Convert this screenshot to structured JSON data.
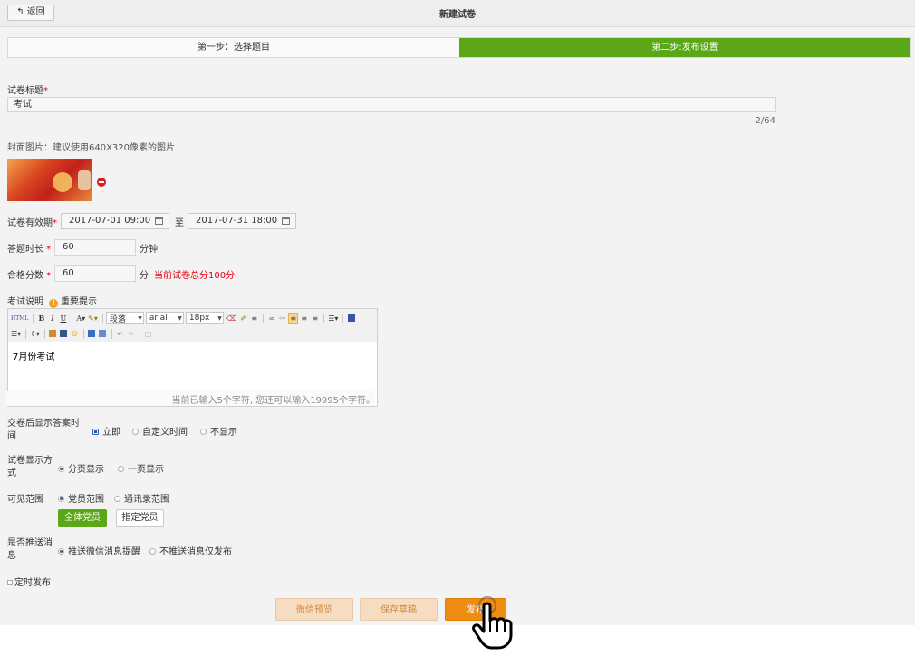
{
  "header": {
    "back_label": "返回",
    "back_icon": "back-arrow-icon",
    "title": "新建试卷"
  },
  "steps": [
    {
      "label": "第一步：选择题目",
      "active": false
    },
    {
      "label": "第二步:发布设置",
      "active": true
    }
  ],
  "colors": {
    "accent_green": "#5aa817",
    "publish_orange": "#ef8d13",
    "required_red": "#e60012"
  },
  "exam_title": {
    "label": "试卷标题",
    "required_mark": "*",
    "value": "考试",
    "counter": "2/64"
  },
  "cover": {
    "label": "封面图片：建议使用640X320像素的图片"
  },
  "validity": {
    "label": "试卷有效期",
    "required_mark": "*",
    "start": "2017-07-01 09:00",
    "separator": "至",
    "end": "2017-07-31 18:00"
  },
  "duration": {
    "label": "答题时长",
    "required_mark": "*",
    "value": "60",
    "unit": "分钟"
  },
  "pass_score": {
    "label": "合格分数",
    "required_mark": "*",
    "value": "60",
    "unit": "分",
    "note": "当前试卷总分100分"
  },
  "description": {
    "label": "考试说明",
    "tip": "重要提示",
    "toolbar": {
      "paragraph": "段落",
      "font": "arial",
      "size": "18px"
    },
    "content": "7月份考试",
    "footer": "当前已输入5个字符, 您还可以输入19995个字符。"
  },
  "show_answer": {
    "label_line1": "交卷后显示答案时",
    "label_line2": "间",
    "options": [
      "立即",
      "自定义时间",
      "不显示"
    ],
    "selected": "立即"
  },
  "display_mode": {
    "label_line1": "试卷显示方",
    "label_line2": "式",
    "options": [
      "分页显示",
      "一页显示"
    ],
    "selected": "分页显示"
  },
  "visibility": {
    "label": "可见范围",
    "options": [
      "党员范围",
      "通讯录范围"
    ],
    "selected": "党员范围",
    "all_members_button": "全体党员",
    "specific_members_button": "指定党员"
  },
  "push": {
    "label_line1": "是否推送消",
    "label_line2": "息",
    "options": [
      "推送微信消息提醒",
      "不推送消息仅发布"
    ],
    "selected": "推送微信消息提醒"
  },
  "scheduled": {
    "label": "定时发布",
    "checked": false
  },
  "actions": {
    "preview": "微信预览",
    "draft": "保存草稿",
    "publish": "发布"
  }
}
